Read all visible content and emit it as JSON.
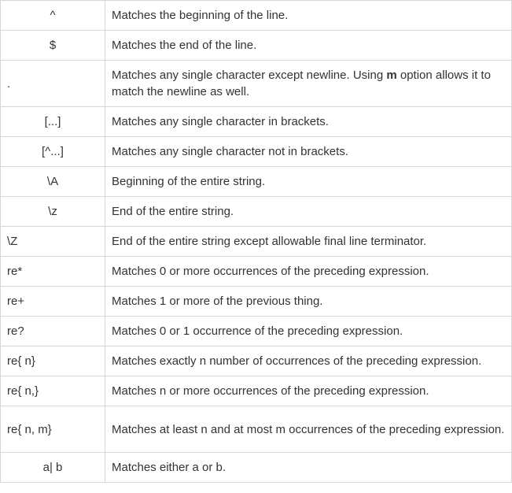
{
  "rows": [
    {
      "pattern": "^",
      "desc": "Matches the beginning of the line."
    },
    {
      "pattern": "$",
      "desc": "Matches the end of the line."
    },
    {
      "pattern": ".",
      "desc_pre": "Matches any single character except newline. Using ",
      "desc_bold": "m",
      "desc_post": " option allows it to match the newline as well."
    },
    {
      "pattern": "[...]",
      "desc": "Matches any single character in brackets."
    },
    {
      "pattern": "[^...]",
      "desc": "Matches any single character not in brackets."
    },
    {
      "pattern": "\\A",
      "desc": "Beginning of the entire string."
    },
    {
      "pattern": "\\z",
      "desc": "End of the entire string."
    },
    {
      "pattern": "\\Z",
      "desc": "End of the entire string except allowable final line terminator."
    },
    {
      "pattern": "re*",
      "desc": "Matches 0 or more occurrences of the preceding expression."
    },
    {
      "pattern": "re+",
      "desc": "Matches 1 or more of the previous thing."
    },
    {
      "pattern": "re?",
      "desc": "Matches 0 or 1 occurrence of the preceding expression."
    },
    {
      "pattern": "re{ n}",
      "desc": "Matches exactly n number of occurrences of the preceding expression."
    },
    {
      "pattern": "re{ n,}",
      "desc": "Matches n or more occurrences of the preceding expression."
    },
    {
      "pattern": "re{ n, m}",
      "desc": "Matches at least n and at most m occurrences of the preceding expression."
    },
    {
      "pattern": "a| b",
      "desc": "Matches either a or b."
    }
  ]
}
